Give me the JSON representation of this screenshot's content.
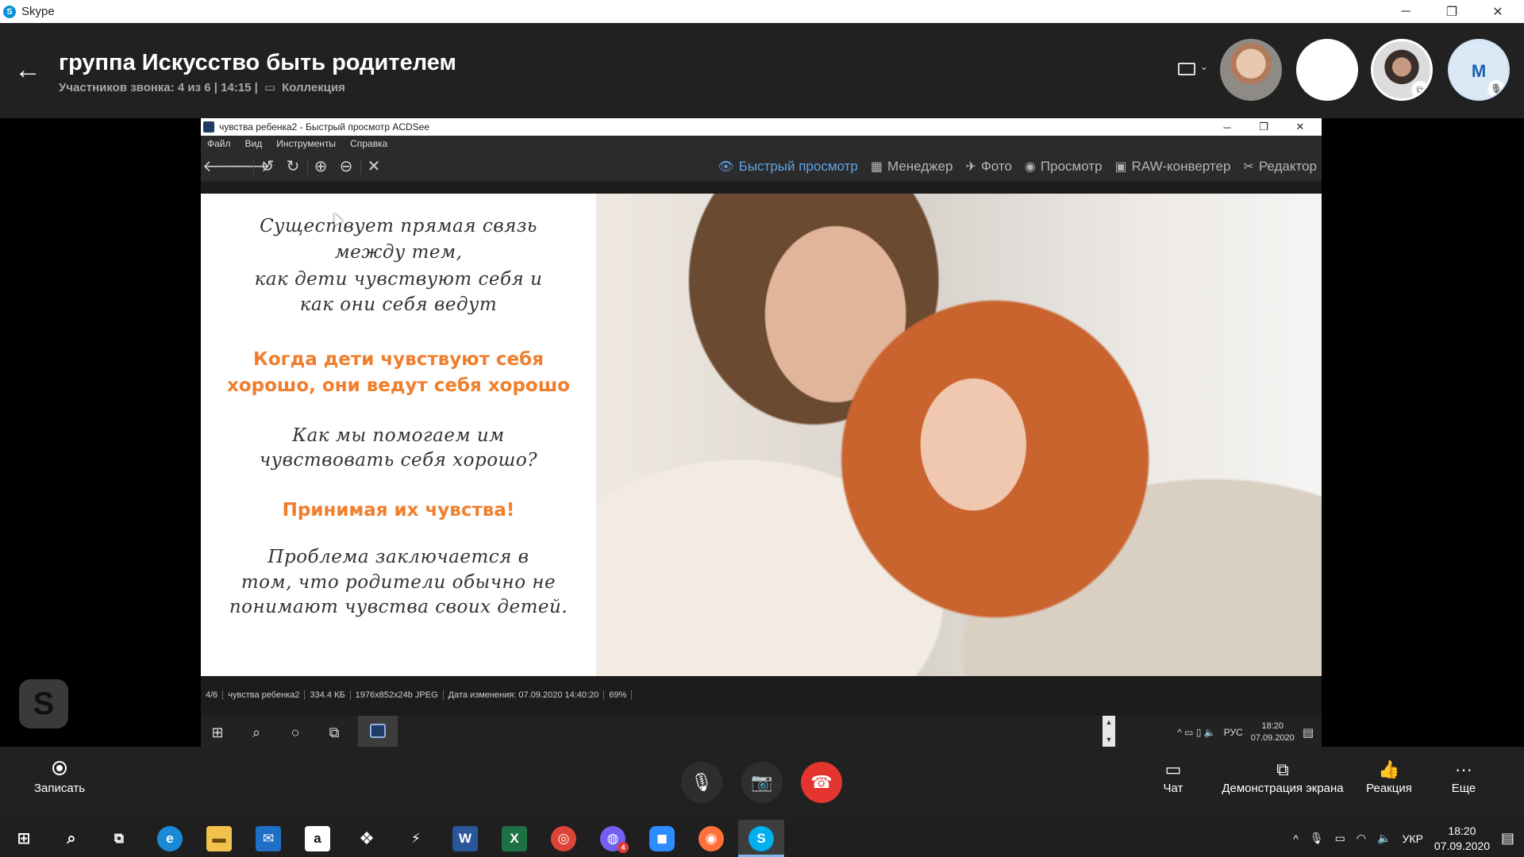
{
  "skype": {
    "window_title": "Skype",
    "logo_letter": "S",
    "controls": {
      "minimize": "─",
      "restore": "❐",
      "close": "✕"
    }
  },
  "call": {
    "back_glyph": "←",
    "title": "группа Искусство быть родителем",
    "participants": "Участников звонка: 4 из 6 | 14:15 |",
    "collection_icon": "▭",
    "collection_label": "Коллекция",
    "avatar_initial": "M"
  },
  "acdsee": {
    "window_title": "чувства ребенка2 - Быстрый просмотр ACDSee",
    "controls": {
      "minimize": "─",
      "restore": "❐",
      "close": "✕"
    },
    "menu": [
      "Файл",
      "Вид",
      "Инструменты",
      "Справка"
    ],
    "tools": {
      "back": "🡐",
      "forward": "🡒",
      "rotate_left": "↺",
      "rotate_right": "↻",
      "zoom_in": "⊕",
      "zoom_out": "⊖",
      "close": "✕"
    },
    "modes": [
      {
        "label": "Быстрый просмотр",
        "icon": "👁",
        "active": true
      },
      {
        "label": "Менеджер",
        "icon": "▦"
      },
      {
        "label": "Фото",
        "icon": "✈"
      },
      {
        "label": "Просмотр",
        "icon": "◉"
      },
      {
        "label": "RAW-конвертер",
        "icon": "▣"
      },
      {
        "label": "Редактор",
        "icon": "✂"
      }
    ],
    "image_text": {
      "p1": [
        "Существует прямая связь",
        "между тем,",
        "как дети чувствуют себя и",
        "как они себя ведут"
      ],
      "p2": [
        "Когда дети чувствуют себя",
        "хорошо, они ведут себя хорошо"
      ],
      "p3": [
        "Как мы помогаем им",
        "чувствовать себя хорошо?"
      ],
      "p4": [
        "Принимая их чувства!"
      ],
      "p5": [
        "Проблема заключается в",
        "том, что родители обычно не",
        "понимают чувства своих детей."
      ]
    },
    "status": [
      "4/6",
      "чувства ребенка2",
      "334.4 КБ",
      "1976x852x24b JPEG",
      "Дата изменения: 07.09.2020 14:40:20",
      "69%"
    ],
    "inner_taskbar": {
      "start": "⊞",
      "search": "⌕",
      "cortana": "○",
      "taskview": "⧉",
      "scroll_up": "▲",
      "scroll_down": "▼",
      "tray_icons": "^ ▭ ▯ 🔈",
      "lang": "РУС",
      "time": "18:20",
      "date": "07.09.2020",
      "notif": "▤"
    }
  },
  "skype_badge_letter": "S",
  "call_controls": {
    "record": "Записать",
    "mic": "🎙",
    "video": "📷",
    "hangup": "☎",
    "chat": "Чат",
    "share": "Демонстрация экрана",
    "reaction": "Реакция",
    "more": "Еще",
    "chat_icon": "▭",
    "share_icon": "⧉",
    "reaction_icon": "👍",
    "more_icon": "···"
  },
  "taskbar": {
    "start": "⊞",
    "search": "⌕",
    "taskview": "⧉",
    "apps": [
      "e",
      "▬",
      "✉",
      "a",
      "❖",
      "⚡",
      "W",
      "X",
      "◎",
      "◍",
      "◼",
      "◉",
      "S"
    ],
    "viber_badge": "4",
    "tray": {
      "chevron": "^",
      "mic": "🎙",
      "battery": "▭",
      "wifi": "◠",
      "volume": "🔈",
      "lang": "УКР",
      "time": "18:20",
      "date": "07.09.2020",
      "notif": "▤"
    }
  },
  "colors": {
    "accent": "#5fa3e8",
    "orange_text": "#f07e2c",
    "hangup": "#e3342f",
    "dark_bg": "#212121"
  }
}
